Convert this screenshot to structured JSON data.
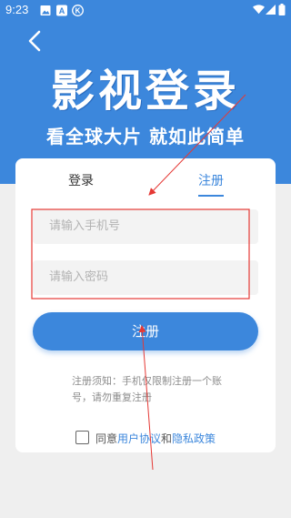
{
  "status_bar": {
    "time": "9:23",
    "icons_left": [
      "image-icon",
      "a-badge-icon",
      "k-badge-icon"
    ],
    "icons_right": [
      "wifi-icon",
      "signal-icon",
      "battery-icon"
    ]
  },
  "header": {
    "back_icon": "chevron-left-icon",
    "title": "影视登录",
    "subtitle": "看全球大片 就如此简单"
  },
  "tabs": [
    {
      "label": "登录",
      "active": false
    },
    {
      "label": "注册",
      "active": true
    }
  ],
  "form": {
    "phone_placeholder": "请输入手机号",
    "password_placeholder": "请输入密码",
    "submit_label": "注册"
  },
  "notice": "注册须知：手机仅限制注册一个账号，请勿重复注册",
  "agreement": {
    "prefix": "同意",
    "user_agreement": "用户协议",
    "conjunction": "和",
    "privacy_policy": "隐私政策",
    "checked": false
  },
  "colors": {
    "accent": "#3c87dc",
    "annotation": "#e53935",
    "background": "#efefef"
  }
}
